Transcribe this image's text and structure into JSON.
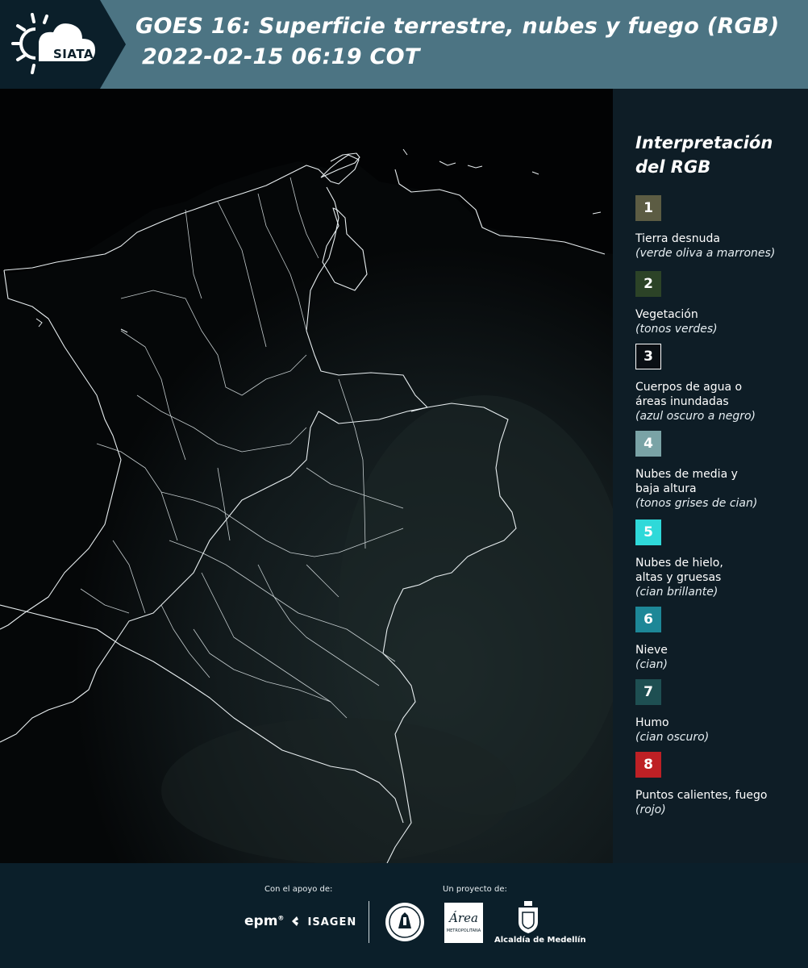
{
  "header": {
    "logo_text": "SIATA",
    "title_line1": "GOES 16: Superficie terrestre, nubes y fuego (RGB)",
    "title_line2": "2022-02-15 06:19 COT"
  },
  "legend": {
    "title": "Interpretación del RGB",
    "items": [
      {
        "number": "1",
        "label": "Tierra desnuda",
        "description": "(verde oliva a marrones)",
        "color": "#5c5c43"
      },
      {
        "number": "2",
        "label": "Vegetación",
        "description": "(tonos verdes)",
        "color": "#2c4327"
      },
      {
        "number": "3",
        "label": "Cuerpos de agua o\náreas inundadas",
        "description": "(azul oscuro a negro)",
        "color": "#0a0f14"
      },
      {
        "number": "4",
        "label": "Nubes de media y\nbaja altura",
        "description": "(tonos grises de cian)",
        "color": "#7aa3a6"
      },
      {
        "number": "5",
        "label": "Nubes de hielo,\naltas y gruesas",
        "description": "(cian brillante)",
        "color": "#2fd9d9"
      },
      {
        "number": "6",
        "label": "Nieve",
        "description": "(cian)",
        "color": "#1d8797"
      },
      {
        "number": "7",
        "label": "Humo",
        "description": "(cian oscuro)",
        "color": "#1e4f52"
      },
      {
        "number": "8",
        "label": "Puntos calientes, fuego",
        "description": "(rojo)",
        "color": "#be2025"
      }
    ]
  },
  "footer": {
    "support_caption": "Con el apoyo de:",
    "project_caption": "Un proyecto de:",
    "epm": "epm",
    "isagen": "ISAGEN",
    "area_metro": "Área",
    "area_metro_sub": "METROPOLITANA",
    "alcaldia": "Alcaldía de Medellín"
  }
}
